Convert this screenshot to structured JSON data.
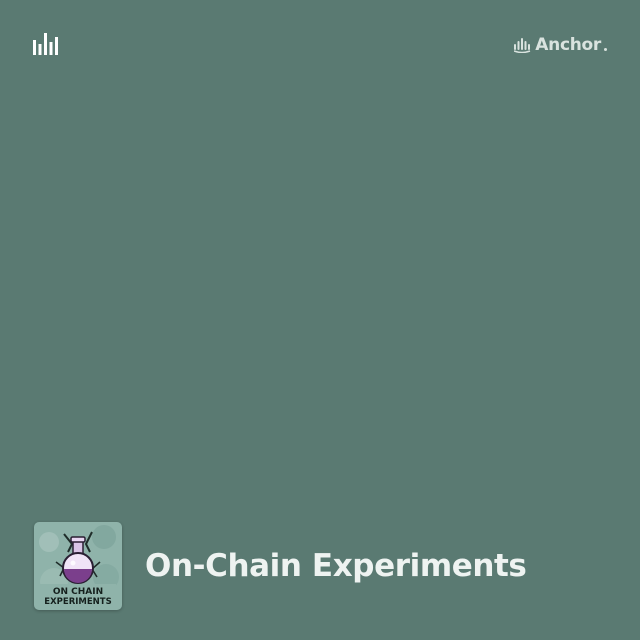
{
  "brand": {
    "label": "Anchor",
    "icon": "anchor-waveform-icon"
  },
  "top_left_icon": "audio-bars-icon",
  "podcast": {
    "title": "On-Chain Experiments",
    "cover_text_line1": "ON CHAIN",
    "cover_text_line2": "EXPERIMENTS",
    "cover_icon": "potion-flask-icon"
  },
  "colors": {
    "background": "#5a7a72",
    "brand_text": "#d9e3df",
    "title_text": "#eef3f1"
  }
}
